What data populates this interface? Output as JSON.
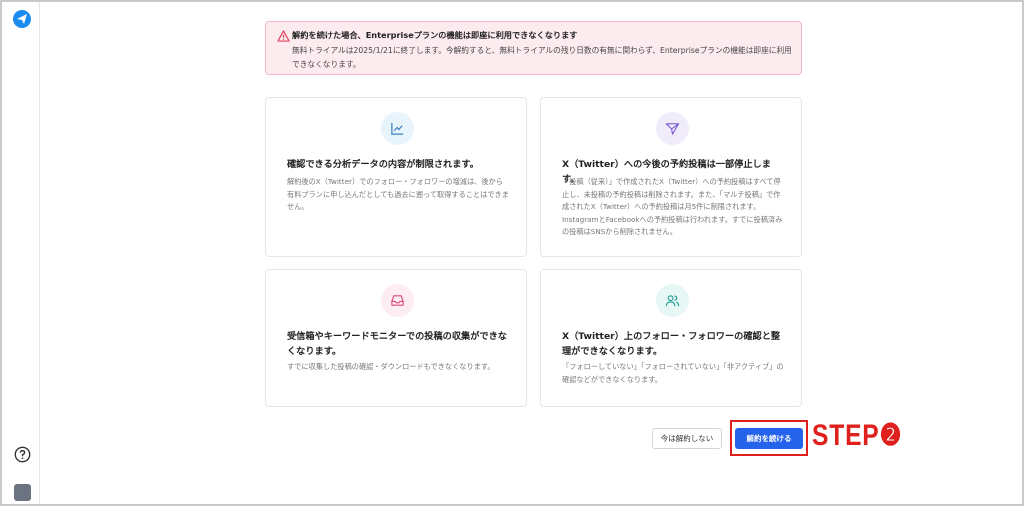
{
  "alert": {
    "title": "解約を続けた場合、Enterpriseプランの機能は即座に利用できなくなります",
    "body": "無料トライアルは2025/1/21に終了します。今解約すると、無料トライアルの残り日数の有無に関わらず、Enterpriseプランの機能は即座に利用できなくなります。"
  },
  "cards": [
    {
      "icon": "line-chart-icon",
      "title": "確認できる分析データの内容が制限されます。",
      "desc": "解約後のX（Twitter）でのフォロー・フォロワーの増減は、後から有料プランに申し込んだとしても過去に遡って取得することはできません。"
    },
    {
      "icon": "send-icon",
      "title": "X（Twitter）への今後の予約投稿は一部停止します。",
      "desc": "「投稿（従来）」で作成されたX（Twitter）への予約投稿はすべて停止し、未投稿の予約投稿は削除されます。また、「マルチ投稿」で作成されたX（Twitter）への予約投稿は月5件に制限されます。InstagramとFacebookへの予約投稿は行われます。すでに投稿済みの投稿はSNSから削除されません。"
    },
    {
      "icon": "inbox-icon",
      "title": "受信箱やキーワードモニターでの投稿の収集ができなくなります。",
      "desc": "すでに収集した投稿の確認・ダウンロードもできなくなります。"
    },
    {
      "icon": "users-icon",
      "title": "X（Twitter）上のフォロー・フォロワーの確認と整理ができなくなります。",
      "desc": "「フォローしていない」「フォローされていない」「非アクティブ」の確認などができなくなります。"
    }
  ],
  "actions": {
    "cancel_label": "今は解約しない",
    "continue_label": "解約を続ける"
  },
  "annotation": {
    "step_label": "STEP❷"
  },
  "colors": {
    "primary": "#2563eb",
    "alert_bg": "#fdecef",
    "annotation_red": "#e0201d"
  }
}
